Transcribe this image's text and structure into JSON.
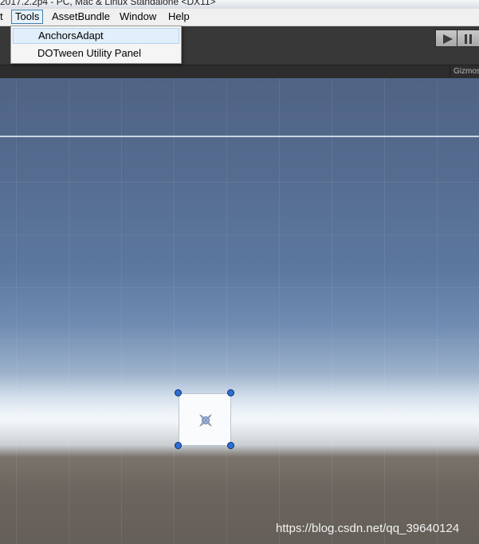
{
  "window": {
    "title": "2017.2.2p4 - PC, Mac & Linux Standalone  <DX11>"
  },
  "menubar": {
    "items": [
      {
        "label": "t"
      },
      {
        "label": "Tools"
      },
      {
        "label": "AssetBundle"
      },
      {
        "label": "Window"
      },
      {
        "label": "Help"
      }
    ]
  },
  "tools_menu": {
    "items": [
      {
        "label": "AnchorsAdapt"
      },
      {
        "label": "DOTween Utility Panel"
      }
    ]
  },
  "scene": {
    "gizmos_label": "Gizmos"
  },
  "watermark": "https://blog.csdn.net/qq_39640124",
  "colors": {
    "toolbar": "#383838",
    "menu_highlight": "#e1eefb",
    "handle_blue": "#2d6fd3",
    "sky_top": "#4f6384",
    "ground": "#6b645e"
  }
}
